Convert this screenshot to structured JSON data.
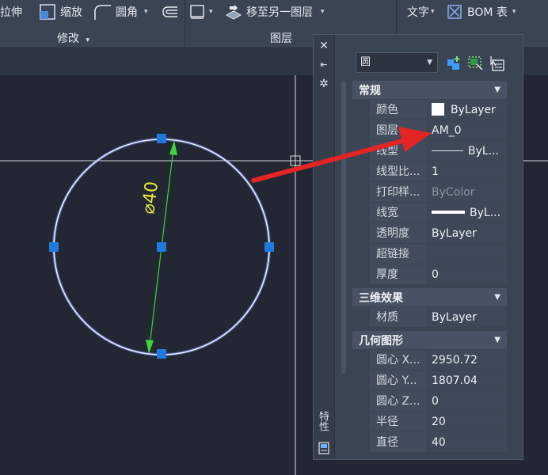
{
  "ribbon": {
    "stretch_label": "拉伸",
    "scale_label": "缩放",
    "fillet_label": "圆角",
    "move_to_layer_label": "移至另一图层",
    "text_label": "文字",
    "bom_label": "BOM 表",
    "modify_panel_label": "修改",
    "layer_panel_label": "图层"
  },
  "drawing": {
    "dimension_text": "⌀40"
  },
  "palette": {
    "vertical_title": "特性",
    "object_type": "圆",
    "categories": [
      {
        "title": "常规",
        "rows": [
          {
            "name": "颜色",
            "value": "ByLayer"
          },
          {
            "name": "图层",
            "value": "AM_0"
          },
          {
            "name": "线型",
            "value": "ByL..."
          },
          {
            "name": "线型比...",
            "value": "1"
          },
          {
            "name": "打印样...",
            "value": "ByColor"
          },
          {
            "name": "线宽",
            "value": "ByL..."
          },
          {
            "name": "透明度",
            "value": "ByLayer"
          },
          {
            "name": "超链接",
            "value": ""
          },
          {
            "name": "厚度",
            "value": "0"
          }
        ]
      },
      {
        "title": "三维效果",
        "rows": [
          {
            "name": "材质",
            "value": "ByLayer"
          }
        ]
      },
      {
        "title": "几何图形",
        "rows": [
          {
            "name": "圆心 X...",
            "value": "2950.72"
          },
          {
            "name": "圆心 Y...",
            "value": "1807.04"
          },
          {
            "name": "圆心 Z...",
            "value": "0"
          },
          {
            "name": "半径",
            "value": "20"
          },
          {
            "name": "直径",
            "value": "40"
          }
        ]
      }
    ]
  },
  "colors": {
    "background": "#222733",
    "circle": "#c8d4ff",
    "dimension": "#3bd63b",
    "grip": "#1f7ae0",
    "arrow": "#e52424"
  }
}
